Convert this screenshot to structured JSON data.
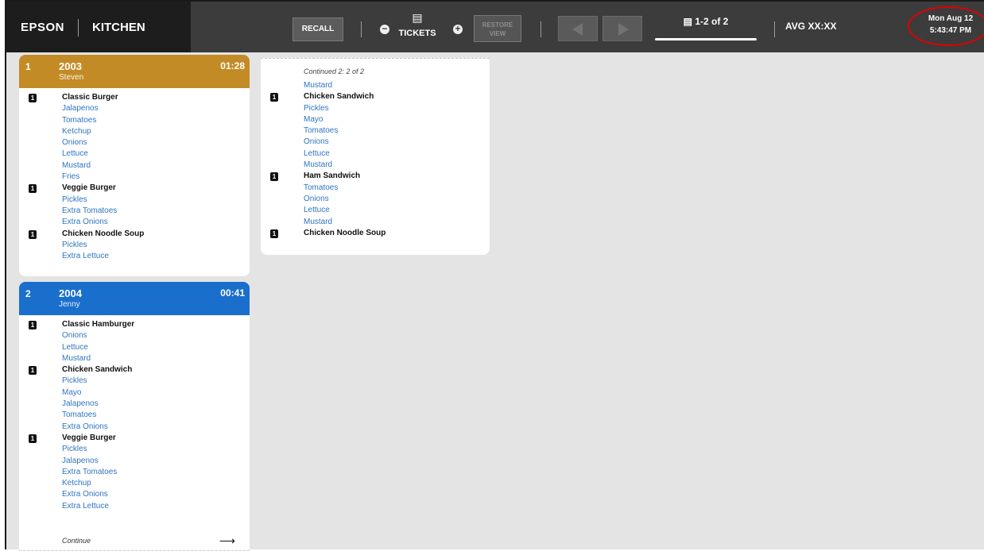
{
  "header": {
    "brand": "EPSON",
    "station": "KITCHEN",
    "recall_label": "RECALL",
    "tickets_label": "TICKETS",
    "restore_label_1": "RESTORE",
    "restore_label_2": "VIEW",
    "page_indicator": "1-2 of 2",
    "avg_label": "AVG XX:XX",
    "date": "Mon Aug 12",
    "time": "5:43:47 PM",
    "icons": [
      "minus-icon",
      "document-icon",
      "plus-icon",
      "prev-arrow-icon",
      "next-arrow-icon"
    ]
  },
  "colors": {
    "ticket1_header": "#c38b25",
    "ticket2_header": "#1a6fcc",
    "modifier_text": "#2f75c0",
    "highlight_ring": "#e00000"
  },
  "tickets": [
    {
      "index": "1",
      "order": "2003",
      "name": "Steven",
      "time": "01:28",
      "lines": [
        {
          "type": "item",
          "qty": "1",
          "text": "Classic Burger"
        },
        {
          "type": "mod",
          "text": "Jalapenos"
        },
        {
          "type": "mod",
          "text": "Tomatoes"
        },
        {
          "type": "mod",
          "text": "Ketchup"
        },
        {
          "type": "mod",
          "text": "Onions"
        },
        {
          "type": "mod",
          "text": "Lettuce"
        },
        {
          "type": "mod",
          "text": "Mustard"
        },
        {
          "type": "mod",
          "text": "Fries"
        },
        {
          "type": "item",
          "qty": "1",
          "text": "Veggie Burger"
        },
        {
          "type": "mod",
          "text": "Pickles"
        },
        {
          "type": "mod",
          "text": "Extra Tomatoes"
        },
        {
          "type": "mod",
          "text": "Extra Onions"
        },
        {
          "type": "item",
          "qty": "1",
          "text": "Chicken Noodle Soup"
        },
        {
          "type": "mod",
          "text": "Pickles"
        },
        {
          "type": "mod",
          "text": "Extra Lettuce"
        }
      ]
    },
    {
      "index": "2",
      "order": "2004",
      "name": "Jenny",
      "time": "00:41",
      "footer": "Continue",
      "lines": [
        {
          "type": "item",
          "qty": "1",
          "text": "Classic Hamburger"
        },
        {
          "type": "mod",
          "text": "Onions"
        },
        {
          "type": "mod",
          "text": "Lettuce"
        },
        {
          "type": "mod",
          "text": "Mustard"
        },
        {
          "type": "item",
          "qty": "1",
          "text": "Chicken Sandwich"
        },
        {
          "type": "mod",
          "text": "Pickles"
        },
        {
          "type": "mod",
          "text": "Mayo"
        },
        {
          "type": "mod",
          "text": "Jalapenos"
        },
        {
          "type": "mod",
          "text": "Tomatoes"
        },
        {
          "type": "mod",
          "text": "Extra Onions"
        },
        {
          "type": "item",
          "qty": "1",
          "text": "Veggie Burger"
        },
        {
          "type": "mod",
          "text": "Pickles"
        },
        {
          "type": "mod",
          "text": "Jalapenos"
        },
        {
          "type": "mod",
          "text": "Extra Tomatoes"
        },
        {
          "type": "mod",
          "text": "Ketchup"
        },
        {
          "type": "mod",
          "text": "Extra Onions"
        },
        {
          "type": "mod",
          "text": "Extra Lettuce"
        }
      ]
    }
  ],
  "continuation": {
    "label": "Continued 2: 2 of 2",
    "lines": [
      {
        "type": "mod",
        "text": "Mustard"
      },
      {
        "type": "item",
        "qty": "1",
        "text": "Chicken Sandwich"
      },
      {
        "type": "mod",
        "text": "Pickles"
      },
      {
        "type": "mod",
        "text": "Mayo"
      },
      {
        "type": "mod",
        "text": "Tomatoes"
      },
      {
        "type": "mod",
        "text": "Onions"
      },
      {
        "type": "mod",
        "text": "Lettuce"
      },
      {
        "type": "mod",
        "text": "Mustard"
      },
      {
        "type": "item",
        "qty": "1",
        "text": "Ham Sandwich"
      },
      {
        "type": "mod",
        "text": "Tomatoes"
      },
      {
        "type": "mod",
        "text": "Onions"
      },
      {
        "type": "mod",
        "text": "Lettuce"
      },
      {
        "type": "mod",
        "text": "Mustard"
      },
      {
        "type": "item",
        "qty": "1",
        "text": "Chicken Noodle Soup"
      }
    ]
  }
}
